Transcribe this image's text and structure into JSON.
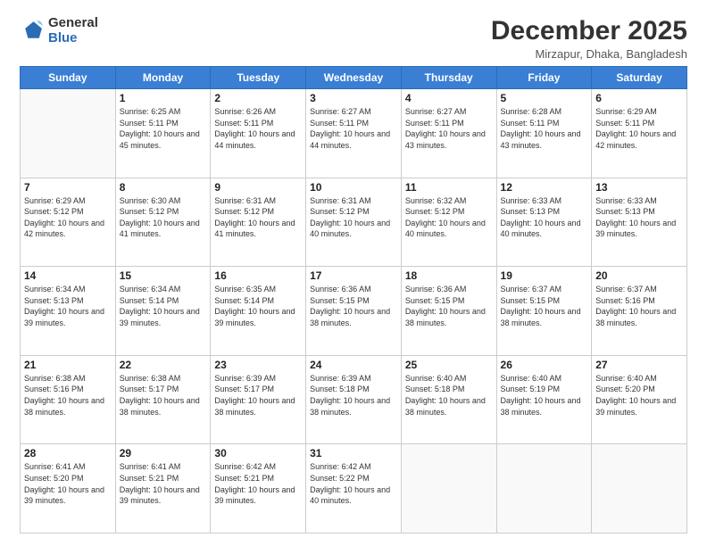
{
  "logo": {
    "line1": "General",
    "line2": "Blue"
  },
  "title": "December 2025",
  "location": "Mirzapur, Dhaka, Bangladesh",
  "days_header": [
    "Sunday",
    "Monday",
    "Tuesday",
    "Wednesday",
    "Thursday",
    "Friday",
    "Saturday"
  ],
  "weeks": [
    [
      {
        "day": "",
        "info": ""
      },
      {
        "day": "1",
        "info": "Sunrise: 6:25 AM\nSunset: 5:11 PM\nDaylight: 10 hours and 45 minutes."
      },
      {
        "day": "2",
        "info": "Sunrise: 6:26 AM\nSunset: 5:11 PM\nDaylight: 10 hours and 44 minutes."
      },
      {
        "day": "3",
        "info": "Sunrise: 6:27 AM\nSunset: 5:11 PM\nDaylight: 10 hours and 44 minutes."
      },
      {
        "day": "4",
        "info": "Sunrise: 6:27 AM\nSunset: 5:11 PM\nDaylight: 10 hours and 43 minutes."
      },
      {
        "day": "5",
        "info": "Sunrise: 6:28 AM\nSunset: 5:11 PM\nDaylight: 10 hours and 43 minutes."
      },
      {
        "day": "6",
        "info": "Sunrise: 6:29 AM\nSunset: 5:11 PM\nDaylight: 10 hours and 42 minutes."
      }
    ],
    [
      {
        "day": "7",
        "info": "Sunrise: 6:29 AM\nSunset: 5:12 PM\nDaylight: 10 hours and 42 minutes."
      },
      {
        "day": "8",
        "info": "Sunrise: 6:30 AM\nSunset: 5:12 PM\nDaylight: 10 hours and 41 minutes."
      },
      {
        "day": "9",
        "info": "Sunrise: 6:31 AM\nSunset: 5:12 PM\nDaylight: 10 hours and 41 minutes."
      },
      {
        "day": "10",
        "info": "Sunrise: 6:31 AM\nSunset: 5:12 PM\nDaylight: 10 hours and 40 minutes."
      },
      {
        "day": "11",
        "info": "Sunrise: 6:32 AM\nSunset: 5:12 PM\nDaylight: 10 hours and 40 minutes."
      },
      {
        "day": "12",
        "info": "Sunrise: 6:33 AM\nSunset: 5:13 PM\nDaylight: 10 hours and 40 minutes."
      },
      {
        "day": "13",
        "info": "Sunrise: 6:33 AM\nSunset: 5:13 PM\nDaylight: 10 hours and 39 minutes."
      }
    ],
    [
      {
        "day": "14",
        "info": "Sunrise: 6:34 AM\nSunset: 5:13 PM\nDaylight: 10 hours and 39 minutes."
      },
      {
        "day": "15",
        "info": "Sunrise: 6:34 AM\nSunset: 5:14 PM\nDaylight: 10 hours and 39 minutes."
      },
      {
        "day": "16",
        "info": "Sunrise: 6:35 AM\nSunset: 5:14 PM\nDaylight: 10 hours and 39 minutes."
      },
      {
        "day": "17",
        "info": "Sunrise: 6:36 AM\nSunset: 5:15 PM\nDaylight: 10 hours and 38 minutes."
      },
      {
        "day": "18",
        "info": "Sunrise: 6:36 AM\nSunset: 5:15 PM\nDaylight: 10 hours and 38 minutes."
      },
      {
        "day": "19",
        "info": "Sunrise: 6:37 AM\nSunset: 5:15 PM\nDaylight: 10 hours and 38 minutes."
      },
      {
        "day": "20",
        "info": "Sunrise: 6:37 AM\nSunset: 5:16 PM\nDaylight: 10 hours and 38 minutes."
      }
    ],
    [
      {
        "day": "21",
        "info": "Sunrise: 6:38 AM\nSunset: 5:16 PM\nDaylight: 10 hours and 38 minutes."
      },
      {
        "day": "22",
        "info": "Sunrise: 6:38 AM\nSunset: 5:17 PM\nDaylight: 10 hours and 38 minutes."
      },
      {
        "day": "23",
        "info": "Sunrise: 6:39 AM\nSunset: 5:17 PM\nDaylight: 10 hours and 38 minutes."
      },
      {
        "day": "24",
        "info": "Sunrise: 6:39 AM\nSunset: 5:18 PM\nDaylight: 10 hours and 38 minutes."
      },
      {
        "day": "25",
        "info": "Sunrise: 6:40 AM\nSunset: 5:18 PM\nDaylight: 10 hours and 38 minutes."
      },
      {
        "day": "26",
        "info": "Sunrise: 6:40 AM\nSunset: 5:19 PM\nDaylight: 10 hours and 38 minutes."
      },
      {
        "day": "27",
        "info": "Sunrise: 6:40 AM\nSunset: 5:20 PM\nDaylight: 10 hours and 39 minutes."
      }
    ],
    [
      {
        "day": "28",
        "info": "Sunrise: 6:41 AM\nSunset: 5:20 PM\nDaylight: 10 hours and 39 minutes."
      },
      {
        "day": "29",
        "info": "Sunrise: 6:41 AM\nSunset: 5:21 PM\nDaylight: 10 hours and 39 minutes."
      },
      {
        "day": "30",
        "info": "Sunrise: 6:42 AM\nSunset: 5:21 PM\nDaylight: 10 hours and 39 minutes."
      },
      {
        "day": "31",
        "info": "Sunrise: 6:42 AM\nSunset: 5:22 PM\nDaylight: 10 hours and 40 minutes."
      },
      {
        "day": "",
        "info": ""
      },
      {
        "day": "",
        "info": ""
      },
      {
        "day": "",
        "info": ""
      }
    ]
  ]
}
